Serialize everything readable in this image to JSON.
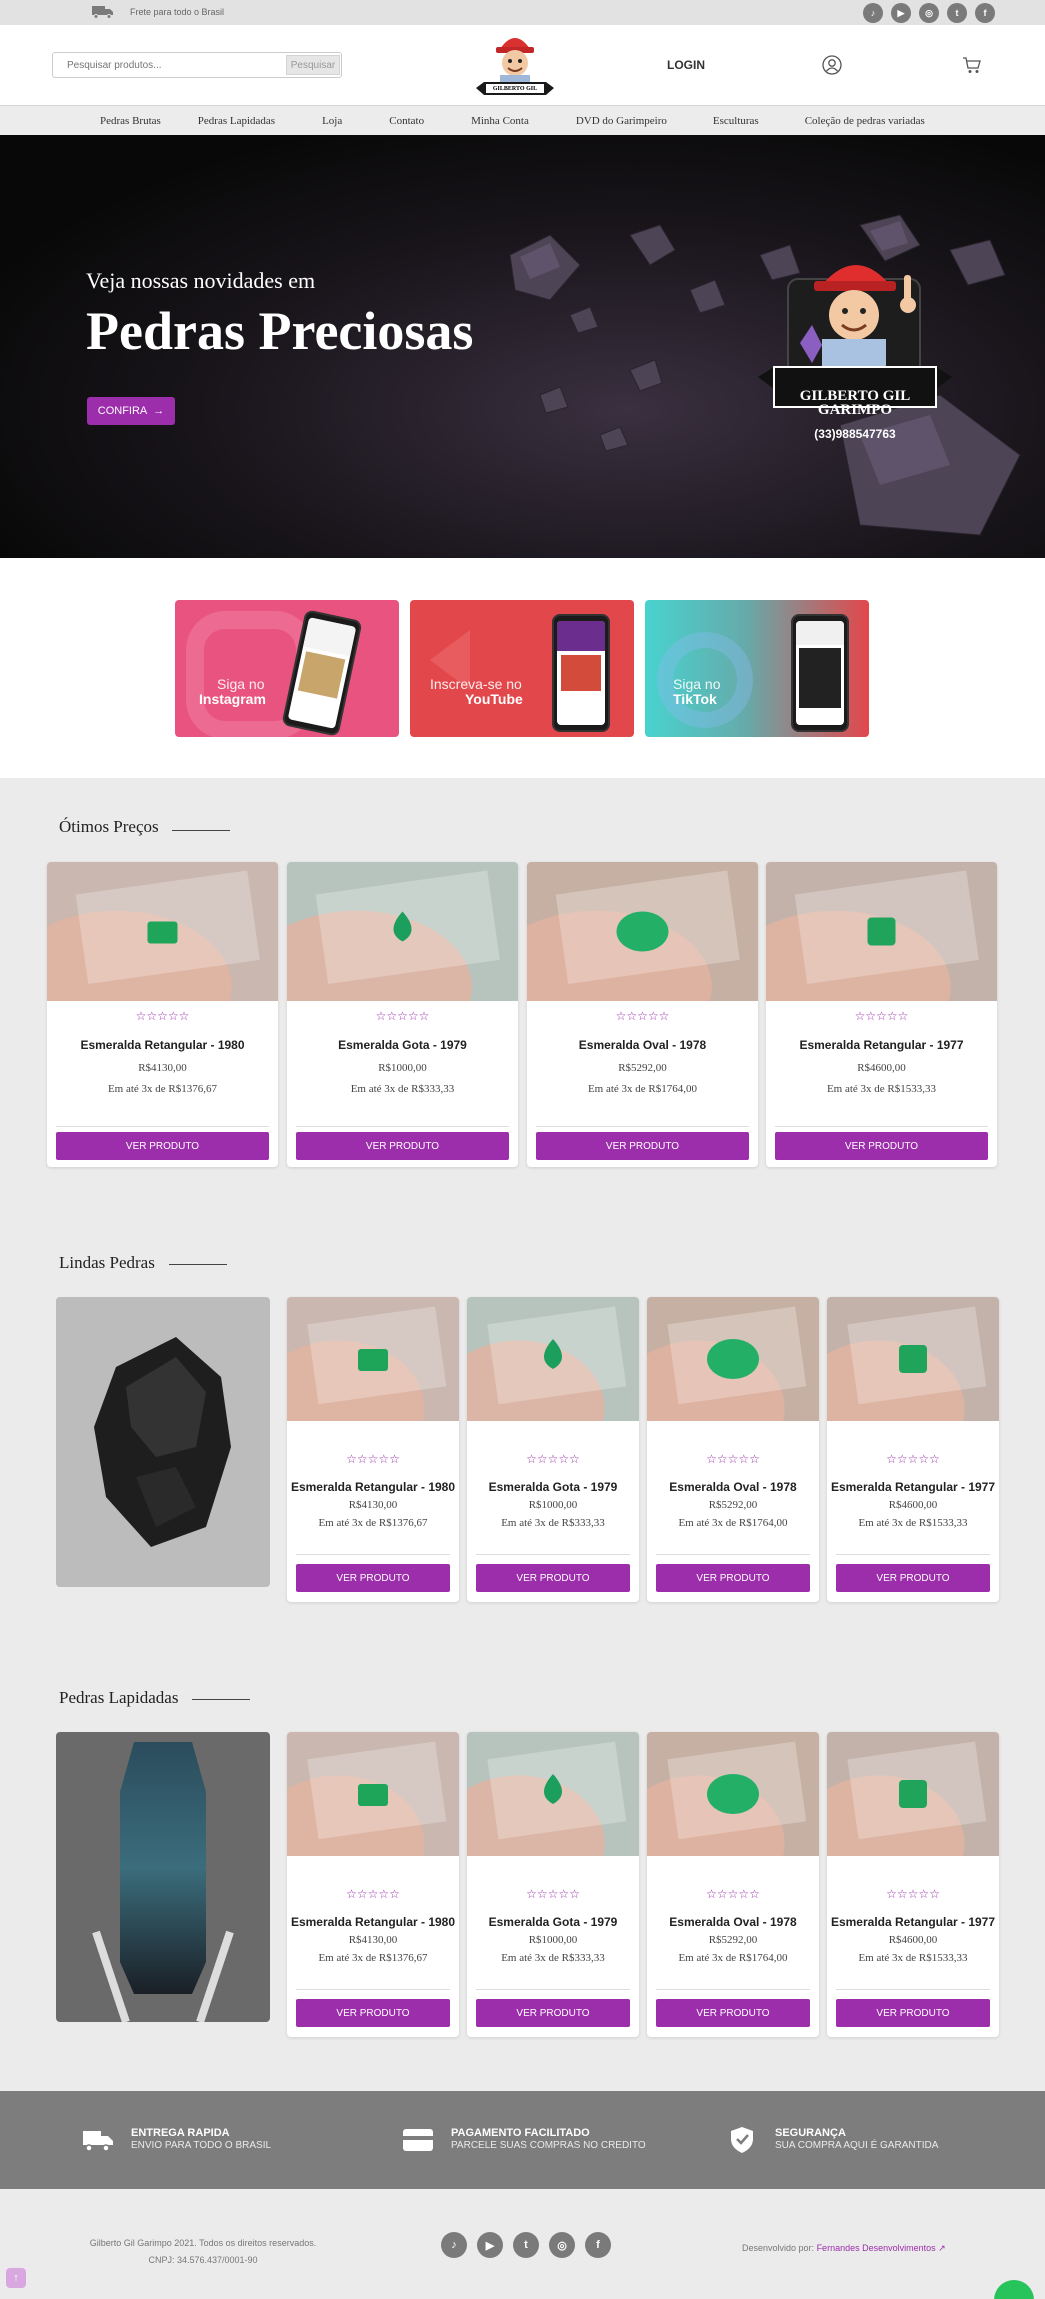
{
  "topbar": {
    "shipping_text": "Frete para todo o Brasil",
    "social_icons": [
      "tiktok-icon",
      "youtube-icon",
      "instagram-icon",
      "twitter-icon",
      "facebook-icon"
    ]
  },
  "header": {
    "search_placeholder": "Pesquisar produtos...",
    "search_button": "Pesquisar",
    "login": "LOGIN"
  },
  "nav": {
    "items": [
      "Pedras Brutas",
      "Pedras Lapidadas",
      "Loja",
      "Contato",
      "Minha Conta",
      "DVD do Garimpeiro",
      "Esculturas",
      "Coleção de pedras variadas"
    ]
  },
  "hero": {
    "subtitle": "Veja nossas novidades em",
    "title": "Pedras Preciosas",
    "button": "CONFIRA",
    "brand_name_1": "GILBERTO GIL",
    "brand_name_2": "GARIMPO",
    "phone": "(33)988547763"
  },
  "banners": [
    {
      "line1": "Siga no",
      "line2": "Instagram"
    },
    {
      "line1": "Inscreva-se no",
      "line2": "YouTube"
    },
    {
      "line1": "Siga no",
      "line2": "TikTok"
    }
  ],
  "products": [
    {
      "name": "Esmeralda Retangular - 1980",
      "price": "R$4130,00",
      "installments": "Em até 3x de R$1376,67"
    },
    {
      "name": "Esmeralda Gota - 1979",
      "price": "R$1000,00",
      "installments": "Em até 3x de R$333,33"
    },
    {
      "name": "Esmeralda Oval - 1978",
      "price": "R$5292,00",
      "installments": "Em até 3x de R$1764,00"
    },
    {
      "name": "Esmeralda Retangular - 1977",
      "price": "R$4600,00",
      "installments": "Em até 3x de R$1533,33"
    }
  ],
  "product_button": "VER PRODUTO",
  "stars": "☆☆☆☆☆",
  "sections": {
    "otimos": "Ótimos Preços",
    "lindas": "Lindas Pedras",
    "lapidadas": "Pedras Lapidadas"
  },
  "features": [
    {
      "title": "ENTREGA RAPIDA",
      "subtitle": "ENVIO PARA TODO O BRASIL",
      "icon": "truck-icon"
    },
    {
      "title": "PAGAMENTO FACILITADO",
      "subtitle": "PARCELE SUAS COMPRAS NO CREDITO",
      "icon": "credit-card-icon"
    },
    {
      "title": "SEGURANÇA",
      "subtitle": "SUA COMPRA AQUI É GARANTIDA",
      "icon": "shield-check-icon"
    }
  ],
  "footer": {
    "copyright": "Gilberto Gil Garimpo 2021. Todos os direitos reservados.",
    "cnpj": "CNPJ: 34.576.437/0001-90",
    "dev_prefix": "Desenvolvido por:",
    "dev_link": "Fernandes Desenvolvimentos"
  },
  "colors": {
    "accent": "#9c2dab",
    "features_bg": "#7d7d7d",
    "instagram": "#e8537f",
    "youtube": "#e2474b",
    "tiktok": "#48d3cf"
  }
}
